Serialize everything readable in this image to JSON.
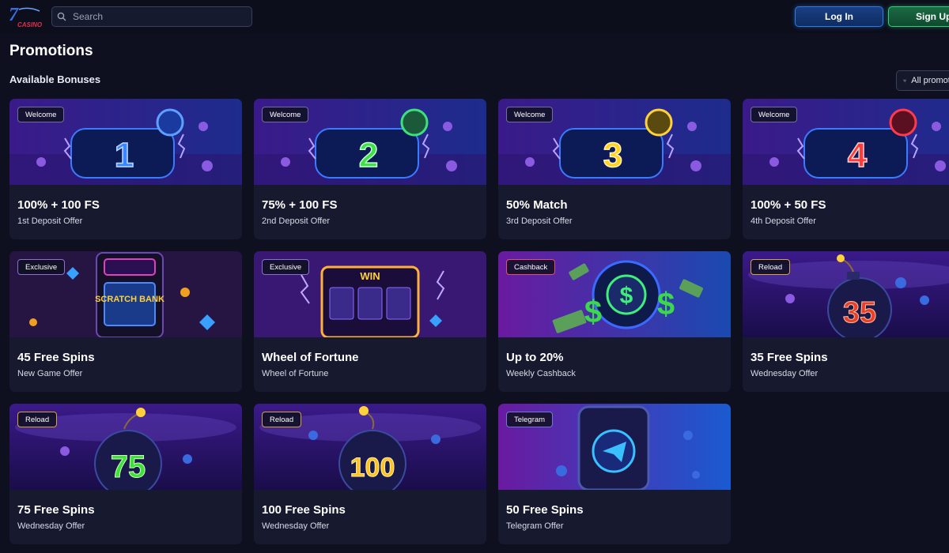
{
  "header": {
    "logo_top": "7",
    "logo_text": "CASINO",
    "search_placeholder": "Search",
    "login_label": "Log In",
    "signup_label": "Sign Up"
  },
  "page": {
    "title": "Promotions",
    "section": "Available Bonuses",
    "filter_label": "All promotions"
  },
  "promotions": [
    {
      "tag": "Welcome",
      "title": "100% + 100 FS",
      "subtitle": "1st Deposit Offer",
      "art": "1"
    },
    {
      "tag": "Welcome",
      "title": "75% + 100 FS",
      "subtitle": "2nd Deposit Offer",
      "art": "2"
    },
    {
      "tag": "Welcome",
      "title": "50% Match",
      "subtitle": "3rd Deposit Offer",
      "art": "3"
    },
    {
      "tag": "Welcome",
      "title": "100% + 50 FS",
      "subtitle": "4th Deposit Offer",
      "art": "4"
    },
    {
      "tag": "Exclusive",
      "title": "45 Free Spins",
      "subtitle": "New Game Offer",
      "art": "SCRATCH BANK"
    },
    {
      "tag": "Exclusive",
      "title": "Wheel of Fortune",
      "subtitle": "Wheel of Fortune",
      "art": "WIN"
    },
    {
      "tag": "Cashback",
      "title": "Up to 20%",
      "subtitle": "Weekly Cashback",
      "art": "$"
    },
    {
      "tag": "Reload",
      "title": "35 Free Spins",
      "subtitle": "Wednesday Offer",
      "art": "35"
    },
    {
      "tag": "Reload",
      "title": "75 Free Spins",
      "subtitle": "Wednesday Offer",
      "art": "75"
    },
    {
      "tag": "Reload",
      "title": "100 Free Spins",
      "subtitle": "Wednesday Offer",
      "art": "100"
    },
    {
      "tag": "Telegram",
      "title": "50 Free Spins",
      "subtitle": "Telegram Offer",
      "art": "telegram-icon"
    }
  ],
  "colors": {
    "background": "#0e1020",
    "card": "#171a2e",
    "login_accent": "#2f7ce0",
    "signup_accent": "#2fd27a"
  }
}
